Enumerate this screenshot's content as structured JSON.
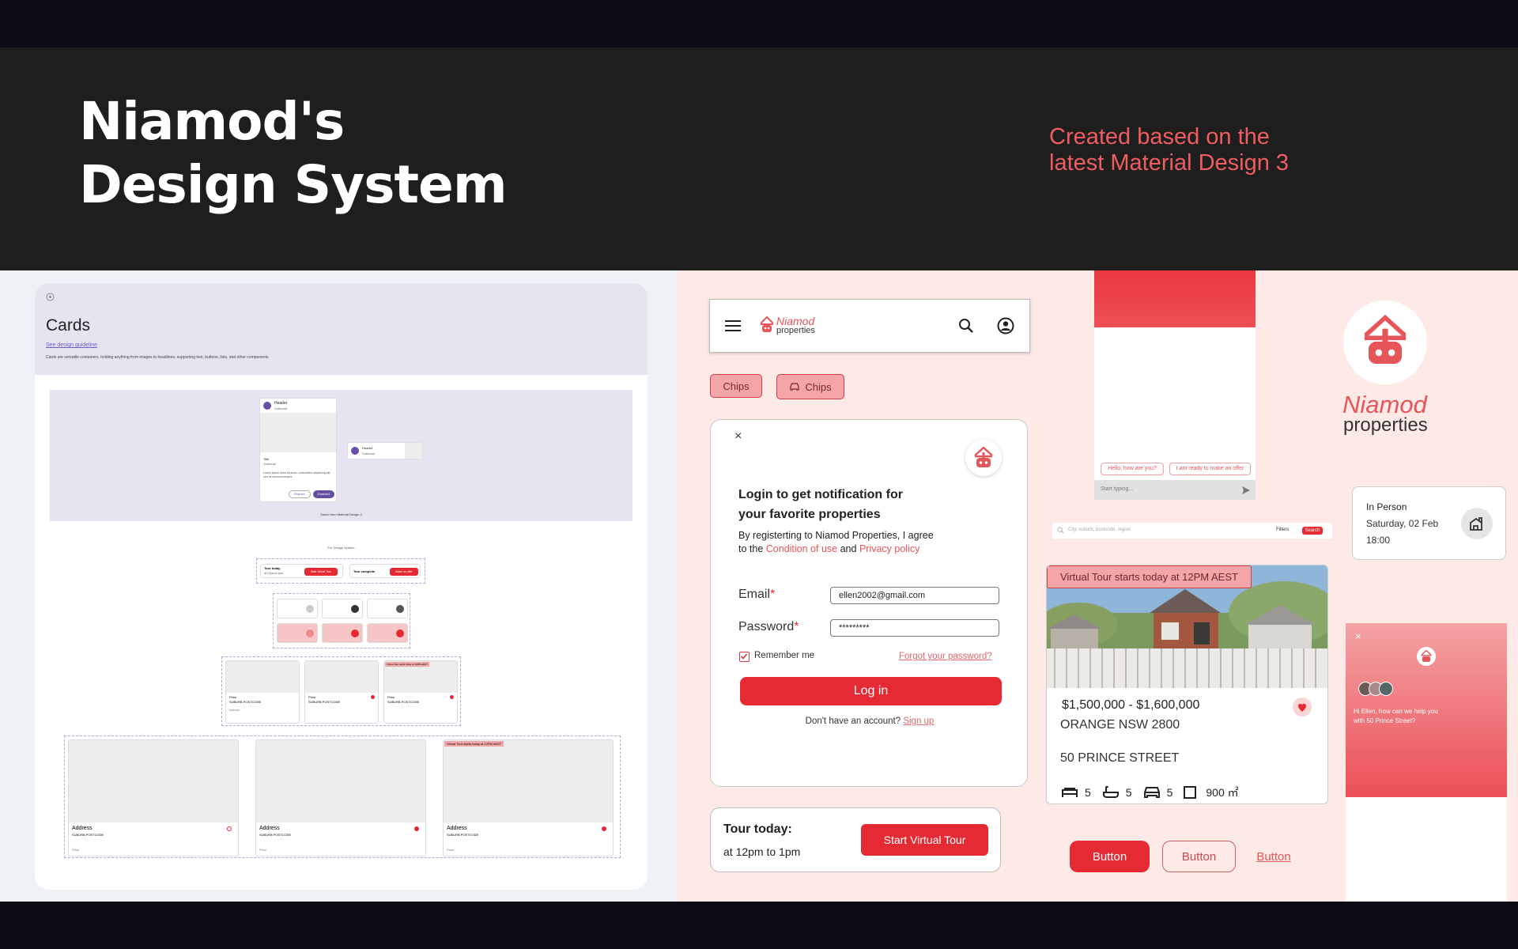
{
  "header": {
    "title_line1": "Niamod's",
    "title_line2": "Design System",
    "subtitle_line1": "Created based on the",
    "subtitle_line2": "latest Material Design 3"
  },
  "cards_doc": {
    "heading": "Cards",
    "link": "See design guideline",
    "description": "Cards are versatile containers, holding anything from images to headlines, supporting text, buttons, lists, and other components",
    "demo_caption": "Saved from Material Design 3",
    "demo_card_title": "Header",
    "demo_card_sub": "Subhead",
    "demo_card_secondary": "Title",
    "demo_card_secondary_sub": "Subhead",
    "demo_card_body": "Lorem ipsum dolor sit amet, consectetur adipiscing elit, sed do eiusmod tempor",
    "demo_btn_outline": "Explore",
    "demo_btn_filled": "Enabled",
    "section_label": "For Design System",
    "mini_tour_title": "Tour today",
    "mini_tour_sub": "at 12pm to 1pm",
    "mini_tour_btn": "Start Virtual Tour",
    "mini_complete": "Tour complete",
    "mini_offer_btn": "Make an offer",
    "card_price": "Price",
    "card_suburb": "SUBURB POSTCODE",
    "card_address": "Address",
    "card_tag": "Virtual Tour starts today at 12PM AEST"
  },
  "app_bar": {
    "brand_top": "Niamod",
    "brand_bottom": "properties"
  },
  "chips": {
    "chip1": "Chips",
    "chip2": "Chips"
  },
  "login": {
    "close": "×",
    "title_line1": "Login to get notification for",
    "title_line2": "your favorite properties",
    "agree_line1": "By registerting to Niamod Properties, I agree",
    "agree_prefix": "to the",
    "condition_link": "Condition of use",
    "and_text": "and",
    "privacy_link": "Privacy policy",
    "email_label": "Email",
    "email_value": "ellen2002@gmail.com",
    "password_label": "Password",
    "password_value": "*********",
    "remember": "Remember me",
    "forgot": "Forgot your password?",
    "login_btn": "Log in",
    "no_account": "Don't have an account?",
    "signup": "Sign up"
  },
  "tour_card": {
    "title": "Tour today:",
    "time": "at 12pm to 1pm",
    "button": "Start Virtual Tour"
  },
  "chat_screen": {
    "suggestion1": "Hello, how are you?",
    "suggestion2": "I am ready to make an offer",
    "input_placeholder": "Start typing..."
  },
  "search_bar": {
    "placeholder": "City, suburb, postcode, region",
    "filters": "Filters",
    "search": "Search"
  },
  "listing": {
    "banner": "Virtual Tour starts today at 12PM AEST",
    "price": "$1,500,000 - $1,600,000",
    "suburb": "ORANGE NSW 2800",
    "street": "50 PRINCE STREET",
    "beds": "5",
    "baths": "5",
    "cars": "5",
    "area": "900 ㎡"
  },
  "buttons": {
    "filled": "Button",
    "outlined": "Button",
    "text": "Button"
  },
  "logo": {
    "name": "Niamod",
    "sub": "properties"
  },
  "in_person": {
    "title": "In Person",
    "date": "Saturday, 02 Feb",
    "time": "18:00"
  },
  "chat_panel": {
    "close": "×",
    "message": "Hi Ellen, how can we help you with 50 Prince Street?"
  },
  "colors": {
    "accent": "#e52a33",
    "subtitle": "#ef5d60",
    "header_bg": "#1e1e1f",
    "right_bg": "#fde9e6"
  }
}
